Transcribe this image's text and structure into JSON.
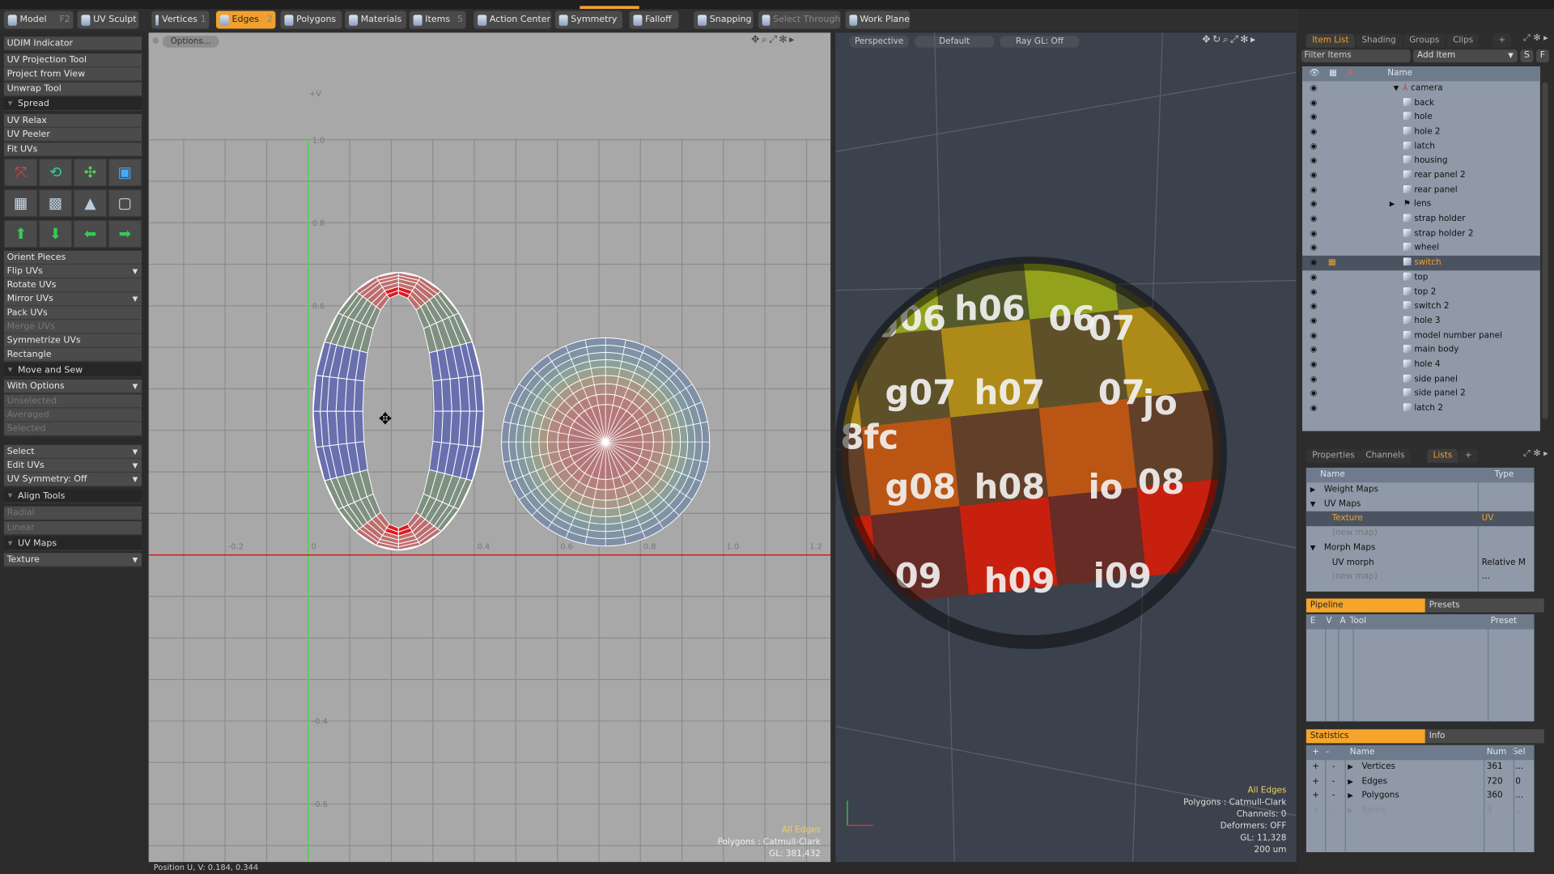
{
  "toolbar": {
    "items": [
      {
        "label": "Model",
        "key": "F2",
        "icon": "sphere-icon"
      },
      {
        "label": "UV Sculpt",
        "key": "",
        "icon": "sculpt-icon"
      },
      {
        "label": "Vertices",
        "key": "1",
        "icon": "vertices-icon"
      },
      {
        "label": "Edges",
        "key": "2",
        "icon": "edges-icon",
        "active": true
      },
      {
        "label": "Polygons",
        "key": "",
        "icon": "polygons-icon"
      },
      {
        "label": "Materials",
        "key": "",
        "icon": "materials-icon"
      },
      {
        "label": "Items",
        "key": "5",
        "icon": "items-icon"
      },
      {
        "label": "Action Center",
        "key": "",
        "icon": "action-center-icon"
      },
      {
        "label": "Symmetry",
        "key": "",
        "icon": "symmetry-icon"
      },
      {
        "label": "Falloff",
        "key": "",
        "icon": "falloff-icon"
      },
      {
        "label": "Snapping",
        "key": "",
        "icon": "snapping-icon"
      },
      {
        "label": "Select Through",
        "key": "",
        "icon": "select-through-icon",
        "disabled": true
      },
      {
        "label": "Work Plane",
        "key": "",
        "icon": "work-plane-icon"
      }
    ]
  },
  "left_panel": {
    "rows": [
      {
        "label": "UDIM Indicator"
      },
      {
        "label": "UV Projection Tool"
      },
      {
        "label": "Project from View"
      },
      {
        "label": "Unwrap Tool"
      },
      {
        "label": "Spread",
        "type": "header"
      },
      {
        "label": "UV Relax"
      },
      {
        "label": "UV Peeler"
      },
      {
        "label": "Fit UVs"
      },
      {
        "label": "Orient Pieces"
      },
      {
        "label": "Flip UVs",
        "type": "dropdown"
      },
      {
        "label": "Rotate UVs"
      },
      {
        "label": "Mirror UVs",
        "type": "dropdown"
      },
      {
        "label": "Pack UVs"
      },
      {
        "label": "Merge UVs",
        "disabled": true
      },
      {
        "label": "Symmetrize UVs"
      },
      {
        "label": "Rectangle"
      },
      {
        "label": "Move and Sew",
        "type": "header"
      },
      {
        "label": "With Options",
        "type": "dropdown"
      },
      {
        "label": "Unselected",
        "disabled": true
      },
      {
        "label": "Averaged",
        "disabled": true
      },
      {
        "label": "Selected",
        "disabled": true
      },
      {
        "label": "Select",
        "type": "dropdown"
      },
      {
        "label": "Edit UVs",
        "type": "dropdown"
      },
      {
        "label": "UV Symmetry: Off",
        "type": "dropdown"
      },
      {
        "label": "Align Tools",
        "type": "header"
      },
      {
        "label": "Radial",
        "disabled": true
      },
      {
        "label": "Linear",
        "disabled": true
      },
      {
        "label": "UV Maps",
        "type": "header"
      },
      {
        "label": "Texture",
        "type": "dropdown"
      }
    ],
    "icon_tools": [
      "uv-projection-planar-icon",
      "uv-cylinder-icon",
      "uv-axis-icon",
      "uv-box-icon",
      "uv-atlas-icon",
      "uv-grid-icon",
      "uv-taper-icon",
      "uv-frame-icon",
      "align-top-icon",
      "align-bottom-icon",
      "align-left-icon",
      "align-right-icon"
    ]
  },
  "uv_viewport": {
    "options_label": "Options...",
    "v_axis_label": "+V",
    "v_ticks": [
      "1.0",
      "0.8",
      "0.6",
      "-0.4",
      "-0.6"
    ],
    "u_ticks": [
      "-0.2",
      "0",
      "0.4",
      "0.6",
      "0.8",
      "1.0",
      "1.2"
    ],
    "overlay": {
      "selection": "All Edges",
      "polygons": "Polygons : Catmull-Clark",
      "gl": "GL: 381,432"
    }
  },
  "viewport_3d": {
    "view_label": "Perspective",
    "style_label": "Default",
    "raygl_label": "Ray GL: Off",
    "texture_labels": [
      "g06",
      "h06",
      "06",
      "07",
      "g07",
      "h07",
      "07",
      "jo",
      "8fc",
      "g08",
      "h08",
      "io",
      "08",
      "09",
      "h09",
      "i09"
    ],
    "overlay": {
      "selection": "All Edges",
      "polygons": "Polygons : Catmull-Clark",
      "channels": "Channels: 0",
      "deformers": "Deformers: OFF",
      "gl": "GL: 11,328",
      "scale": "200 um"
    },
    "colors": {
      "green": "#3a9a22",
      "yellow": "#a8a41c",
      "red": "#c8200e"
    }
  },
  "item_list": {
    "tabs": [
      "Item List",
      "Shading",
      "Groups",
      "Clips",
      "+"
    ],
    "filter_placeholder": "Filter Items",
    "add_item": "Add Item",
    "s_label": "S",
    "f_label": "F",
    "name_header": "Name",
    "items": [
      {
        "name": "camera",
        "type": "camera"
      },
      {
        "name": "back"
      },
      {
        "name": "hole"
      },
      {
        "name": "hole 2"
      },
      {
        "name": "latch"
      },
      {
        "name": "housing"
      },
      {
        "name": "rear panel 2"
      },
      {
        "name": "rear panel"
      },
      {
        "name": "lens",
        "type": "group"
      },
      {
        "name": "strap holder"
      },
      {
        "name": "strap holder 2"
      },
      {
        "name": "wheel"
      },
      {
        "name": "switch",
        "selected": true
      },
      {
        "name": "top"
      },
      {
        "name": "top 2"
      },
      {
        "name": "switch 2"
      },
      {
        "name": "hole 3"
      },
      {
        "name": "model number panel"
      },
      {
        "name": "main body"
      },
      {
        "name": "hole 4"
      },
      {
        "name": "side panel"
      },
      {
        "name": "side panel 2"
      },
      {
        "name": "latch 2"
      }
    ]
  },
  "lists_panel": {
    "tabs": [
      "Properties",
      "Channels",
      "Lists",
      "+"
    ],
    "headers": [
      "Name",
      "Type"
    ],
    "rows": [
      {
        "name": "Weight Maps",
        "type": "",
        "level": 0,
        "arrow": "▶"
      },
      {
        "name": "UV Maps",
        "type": "",
        "level": 0,
        "arrow": "▼"
      },
      {
        "name": "Texture",
        "type": "UV",
        "level": 1,
        "selected": true
      },
      {
        "name": "(new map)",
        "type": "",
        "level": 1,
        "dim": true
      },
      {
        "name": "Morph Maps",
        "type": "",
        "level": 0,
        "arrow": "▼"
      },
      {
        "name": "UV morph",
        "type": "Relative M …",
        "level": 1
      },
      {
        "name": "(new map)",
        "type": "",
        "level": 1,
        "dim": true
      }
    ]
  },
  "pipeline": {
    "tabs": [
      "Pipeline",
      "Presets"
    ],
    "headers": [
      "E",
      "V",
      "A",
      "Tool",
      "Preset"
    ]
  },
  "statistics": {
    "tabs": [
      "Statistics",
      "Info"
    ],
    "headers": [
      "+",
      "-",
      "Name",
      "Num",
      "Sel"
    ],
    "rows": [
      {
        "name": "Vertices",
        "num": "361",
        "sel": "..."
      },
      {
        "name": "Edges",
        "num": "720",
        "sel": "0"
      },
      {
        "name": "Polygons",
        "num": "360",
        "sel": "..."
      },
      {
        "name": "Items",
        "num": "3",
        "sel": "...",
        "dim": true
      }
    ]
  },
  "status_bar": {
    "position": "Position U, V:  0.184, 0.344"
  },
  "accent": "#f0a030"
}
